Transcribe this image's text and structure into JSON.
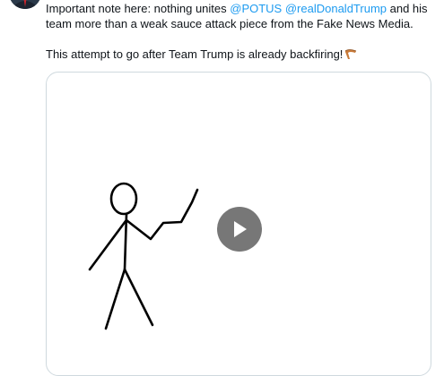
{
  "tweet": {
    "line1_pre": "Important note here: nothing unites ",
    "mention1": "@POTUS",
    "space": " ",
    "mention2": "@realDonaldTrump",
    "line1_post": " and his team more than a weak sauce attack piece from the Fake News Media.",
    "line2": "This attempt to go after Team Trump is already backfiring!",
    "emoji_icon": "boomerang-icon"
  },
  "media": {
    "type": "video",
    "play_icon": "play-icon",
    "content": "stick-figure-drawing"
  },
  "colors": {
    "mention": "#1d9bf0",
    "text": "#0f1419",
    "card_border": "#cfd9de",
    "play_bg": "#646464"
  }
}
